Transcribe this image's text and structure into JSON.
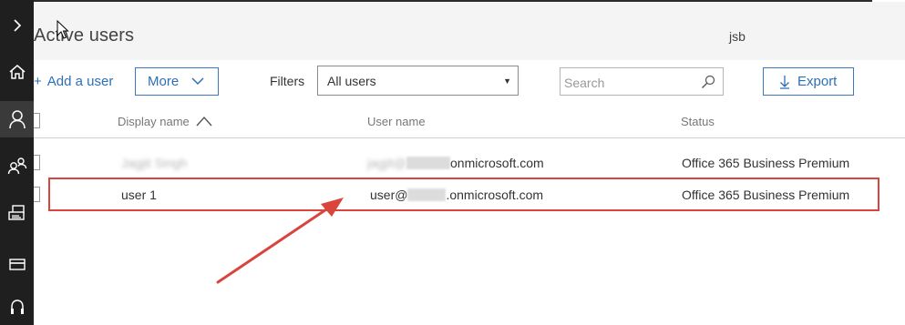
{
  "page": {
    "title": "Active users",
    "tenant": "jsb"
  },
  "nav": {
    "items": [
      {
        "name": "expand-icon"
      },
      {
        "name": "home-icon"
      },
      {
        "name": "user-icon"
      },
      {
        "name": "groups-icon"
      },
      {
        "name": "devices-icon"
      },
      {
        "name": "billing-icon"
      },
      {
        "name": "support-icon"
      }
    ]
  },
  "toolbar": {
    "add_label": "Add a user",
    "more_label": "More",
    "filters_label": "Filters",
    "filter_value": "All users",
    "search_placeholder": "Search",
    "export_label": "Export"
  },
  "table": {
    "columns": [
      "Display name",
      "User name",
      "Status"
    ],
    "sort_column": "Display name",
    "rows": [
      {
        "display_name": "Jagjit Singh",
        "user_name_prefix": "jagjit@",
        "user_name_domain": "onmicrosoft.com",
        "status": "Office 365 Business Premium",
        "redacted": true
      },
      {
        "display_name": "user 1",
        "user_name_prefix": "user@",
        "user_name_domain": ".onmicrosoft.com",
        "status": "Office 365 Business Premium",
        "redacted": false
      }
    ]
  },
  "annotation": {
    "color": "#d9453c"
  },
  "colors": {
    "accent": "#2e6fb5",
    "rail": "#1f1f1f",
    "header_bg": "#f4f4f4"
  }
}
